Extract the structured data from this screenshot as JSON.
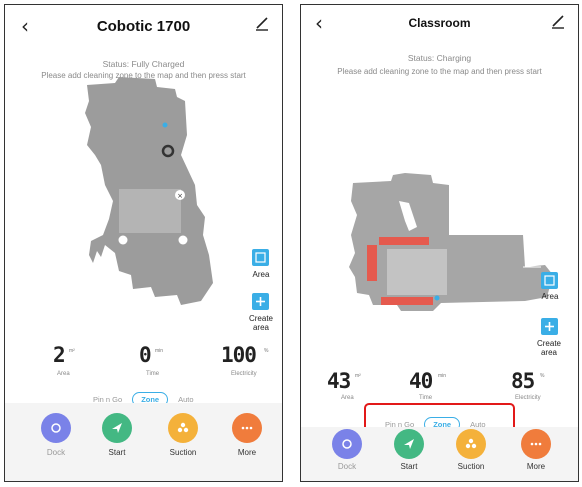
{
  "left_screen": {
    "title": "Cobotic 1700",
    "status": "Status: Fully Charged",
    "instruction": "Please add cleaning zone to the map and then press start",
    "side_buttons": {
      "area_label": "Area",
      "create_area_label": "Create area"
    },
    "stats": [
      {
        "value": "2",
        "unit": "m²",
        "label": "Area"
      },
      {
        "value": "0",
        "unit": "min",
        "label": "Time"
      },
      {
        "value": "100",
        "unit": "%",
        "label": "Electricity"
      }
    ],
    "modes": {
      "pin_go": "Pin n Go",
      "zone": "Zone",
      "auto": "Auto"
    },
    "actions": {
      "dock": "Dock",
      "start": "Start",
      "suction": "Suction",
      "more": "More"
    }
  },
  "right_screen": {
    "title": "Classroom",
    "status": "Status: Charging",
    "instruction": "Please add cleaning zone to the map and then press start",
    "side_buttons": {
      "area_label": "Area",
      "create_area_label": "Create area"
    },
    "stats": [
      {
        "value": "43",
        "unit": "m²",
        "label": "Area"
      },
      {
        "value": "40",
        "unit": "min",
        "label": "Time"
      },
      {
        "value": "85",
        "unit": "%",
        "label": "Electricity"
      }
    ],
    "modes": {
      "pin_go": "Pin n Go",
      "zone": "Zone",
      "auto": "Auto"
    },
    "actions": {
      "dock": "Dock",
      "start": "Start",
      "suction": "Suction",
      "more": "More"
    }
  },
  "colors": {
    "accent": "#3aaee6",
    "dock": "#7a82e8",
    "start": "#43b883",
    "suction": "#f4b13a",
    "more": "#f07c3c",
    "zone_red": "#e55a4e",
    "highlight": "#e21919",
    "map_gray": "#9c9c9c"
  }
}
